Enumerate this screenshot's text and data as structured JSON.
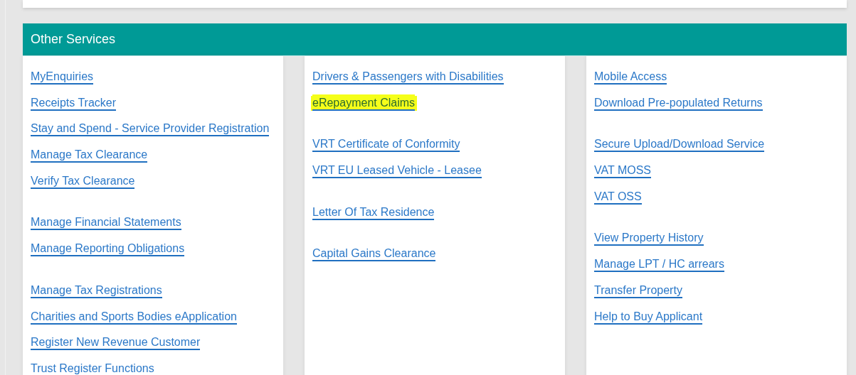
{
  "panel": {
    "title": "Other Services"
  },
  "columns": [
    {
      "groups": [
        {
          "links": [
            {
              "label": "MyEnquiries",
              "highlighted": false
            },
            {
              "label": "Receipts Tracker",
              "highlighted": false
            },
            {
              "label": "Stay and Spend - Service Provider Registration",
              "highlighted": false
            },
            {
              "label": "Manage Tax Clearance",
              "highlighted": false
            },
            {
              "label": "Verify Tax Clearance",
              "highlighted": false
            }
          ]
        },
        {
          "links": [
            {
              "label": "Manage Financial Statements",
              "highlighted": false
            },
            {
              "label": "Manage Reporting Obligations",
              "highlighted": false
            }
          ]
        },
        {
          "links": [
            {
              "label": "Manage Tax Registrations",
              "highlighted": false
            },
            {
              "label": "Charities and Sports Bodies eApplication",
              "highlighted": false
            },
            {
              "label": "Register New Revenue Customer",
              "highlighted": false
            },
            {
              "label": "Trust Register Functions",
              "highlighted": false
            }
          ]
        }
      ]
    },
    {
      "groups": [
        {
          "links": [
            {
              "label": "Drivers & Passengers with Disabilities",
              "highlighted": false
            },
            {
              "label": "eRepayment Claims",
              "highlighted": true
            }
          ]
        },
        {
          "links": [
            {
              "label": "VRT Certificate of Conformity",
              "highlighted": false
            },
            {
              "label": "VRT EU Leased Vehicle - Leasee",
              "highlighted": false
            }
          ]
        },
        {
          "links": [
            {
              "label": "Letter Of Tax Residence",
              "highlighted": false
            }
          ]
        },
        {
          "links": [
            {
              "label": "Capital Gains Clearance",
              "highlighted": false
            }
          ]
        }
      ]
    },
    {
      "groups": [
        {
          "links": [
            {
              "label": "Mobile Access",
              "highlighted": false
            },
            {
              "label": "Download Pre-populated Returns",
              "highlighted": false
            }
          ]
        },
        {
          "links": [
            {
              "label": "Secure Upload/Download Service",
              "highlighted": false
            },
            {
              "label": "VAT MOSS",
              "highlighted": false
            },
            {
              "label": "VAT OSS",
              "highlighted": false
            }
          ]
        },
        {
          "links": [
            {
              "label": "View Property History",
              "highlighted": false
            },
            {
              "label": "Manage LPT / HC arrears",
              "highlighted": false
            },
            {
              "label": "Transfer Property",
              "highlighted": false
            },
            {
              "label": "Help to Buy Applicant",
              "highlighted": false
            }
          ]
        }
      ]
    }
  ]
}
